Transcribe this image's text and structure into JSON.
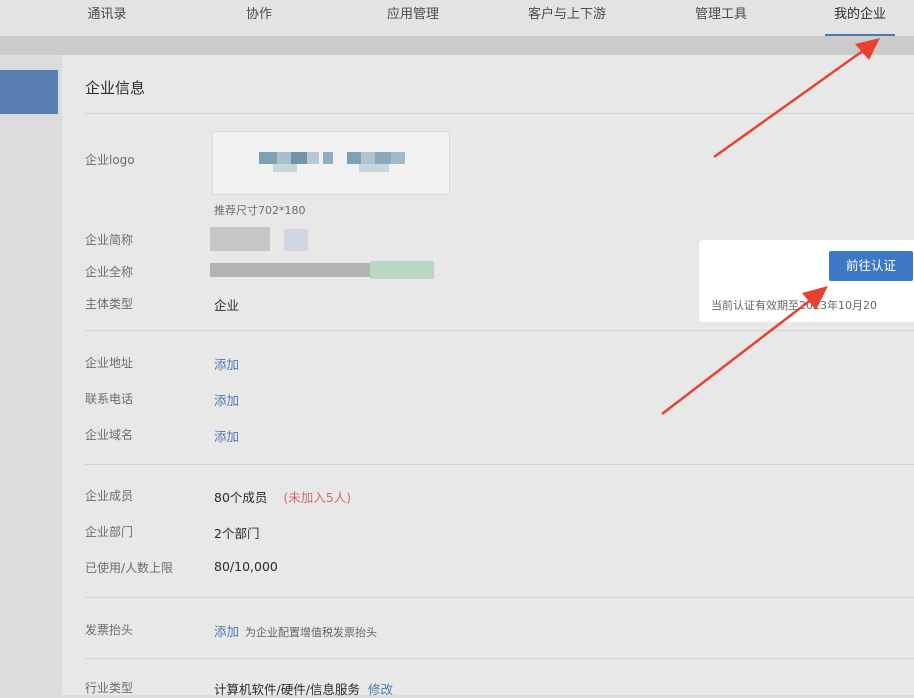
{
  "nav": {
    "tabs": [
      {
        "label": "通讯录"
      },
      {
        "label": "协作"
      },
      {
        "label": "应用管理"
      },
      {
        "label": "客户与上下游"
      },
      {
        "label": "管理工具"
      },
      {
        "label": "我的企业"
      }
    ],
    "active_tab": "我的企业"
  },
  "page": {
    "title": "企业信息",
    "logo": {
      "label": "企业logo",
      "hint": "推荐尺寸702*180"
    },
    "short_name": {
      "label": "企业简称"
    },
    "full_name": {
      "label": "企业全称"
    },
    "entity_type": {
      "label": "主体类型",
      "value": "企业"
    },
    "address": {
      "label": "企业地址",
      "action": "添加"
    },
    "phone": {
      "label": "联系电话",
      "action": "添加"
    },
    "domain": {
      "label": "企业域名",
      "action": "添加"
    },
    "members": {
      "label": "企业成员",
      "value": "80个成员",
      "note": "(未加入5人)"
    },
    "departments": {
      "label": "企业部门",
      "value": "2个部门"
    },
    "usage": {
      "label": "已使用/人数上限",
      "value": "80/10,000"
    },
    "invoice": {
      "label": "发票抬头",
      "action": "添加",
      "hint": "为企业配置增值税发票抬头"
    },
    "industry": {
      "label": "行业类型",
      "value": "计算机软件/硬件/信息服务",
      "action": "修改"
    }
  },
  "verification": {
    "button_label": "前往认证",
    "status_text": "当前认证有效期至2023年10月20"
  },
  "colors": {
    "accent": "#3c78c4",
    "link": "#4d79b5",
    "annotation_arrow": "#e8412f",
    "warning": "#d46a6a"
  }
}
